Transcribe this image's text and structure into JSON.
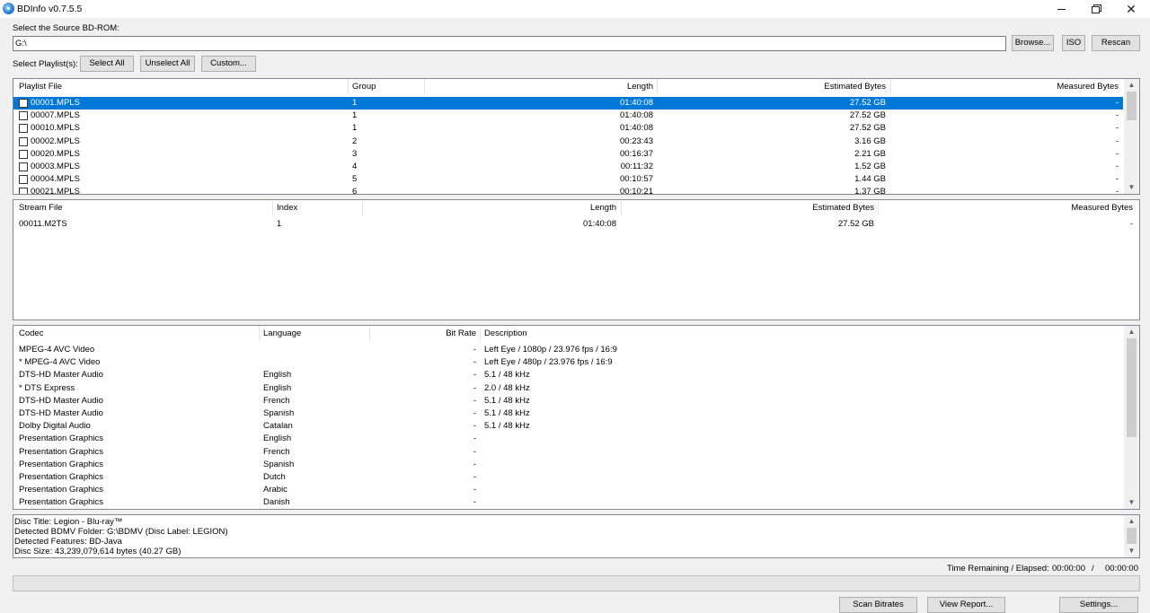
{
  "window": {
    "title": "BDInfo v0.7.5.5",
    "minimize": "–",
    "maximize": "❐",
    "close": "✕"
  },
  "source": {
    "label": "Select the Source BD-ROM:",
    "path": "G:\\",
    "browse": "Browse...",
    "iso": "ISO",
    "rescan": "Rescan"
  },
  "playlists": {
    "label": "Select Playlist(s):",
    "select_all": "Select All",
    "unselect_all": "Unselect All",
    "custom": "Custom...",
    "columns": [
      "Playlist File",
      "Group",
      "Length",
      "Estimated Bytes",
      "Measured Bytes"
    ],
    "rows": [
      {
        "file": "00001.MPLS",
        "group": "1",
        "length": "01:40:08",
        "est": "27.52 GB",
        "meas": "-",
        "selected": true
      },
      {
        "file": "00007.MPLS",
        "group": "1",
        "length": "01:40:08",
        "est": "27.52 GB",
        "meas": "-"
      },
      {
        "file": "00010.MPLS",
        "group": "1",
        "length": "01:40:08",
        "est": "27.52 GB",
        "meas": "-"
      },
      {
        "file": "00002.MPLS",
        "group": "2",
        "length": "00:23:43",
        "est": "3.16 GB",
        "meas": "-"
      },
      {
        "file": "00020.MPLS",
        "group": "3",
        "length": "00:16:37",
        "est": "2.21 GB",
        "meas": "-"
      },
      {
        "file": "00003.MPLS",
        "group": "4",
        "length": "00:11:32",
        "est": "1.52 GB",
        "meas": "-"
      },
      {
        "file": "00004.MPLS",
        "group": "5",
        "length": "00:10:57",
        "est": "1.44 GB",
        "meas": "-"
      },
      {
        "file": "00021.MPLS",
        "group": "6",
        "length": "00:10:21",
        "est": "1.37 GB",
        "meas": "-"
      }
    ]
  },
  "streams": {
    "columns": [
      "Stream File",
      "Index",
      "Length",
      "Estimated Bytes",
      "Measured Bytes"
    ],
    "rows": [
      {
        "file": "00011.M2TS",
        "index": "1",
        "length": "01:40:08",
        "est": "27.52 GB",
        "meas": "-"
      }
    ]
  },
  "codecs": {
    "columns": [
      "Codec",
      "Language",
      "Bit Rate",
      "Description"
    ],
    "rows": [
      {
        "codec": "MPEG-4 AVC Video",
        "lang": "",
        "bitrate": "-",
        "desc": "Left Eye / 1080p / 23.976 fps / 16:9"
      },
      {
        "codec": "* MPEG-4 AVC Video",
        "lang": "",
        "bitrate": "-",
        "desc": "Left Eye / 480p / 23.976 fps / 16:9"
      },
      {
        "codec": "DTS-HD Master Audio",
        "lang": "English",
        "bitrate": "-",
        "desc": "5.1 / 48 kHz"
      },
      {
        "codec": "* DTS Express",
        "lang": "English",
        "bitrate": "-",
        "desc": "2.0 / 48 kHz"
      },
      {
        "codec": "DTS-HD Master Audio",
        "lang": "French",
        "bitrate": "-",
        "desc": "5.1 / 48 kHz"
      },
      {
        "codec": "DTS-HD Master Audio",
        "lang": "Spanish",
        "bitrate": "-",
        "desc": "5.1 / 48 kHz"
      },
      {
        "codec": "Dolby Digital Audio",
        "lang": "Catalan",
        "bitrate": "-",
        "desc": "5.1 / 48 kHz"
      },
      {
        "codec": "Presentation Graphics",
        "lang": "English",
        "bitrate": "-",
        "desc": ""
      },
      {
        "codec": "Presentation Graphics",
        "lang": "French",
        "bitrate": "-",
        "desc": ""
      },
      {
        "codec": "Presentation Graphics",
        "lang": "Spanish",
        "bitrate": "-",
        "desc": ""
      },
      {
        "codec": "Presentation Graphics",
        "lang": "Dutch",
        "bitrate": "-",
        "desc": ""
      },
      {
        "codec": "Presentation Graphics",
        "lang": "Arabic",
        "bitrate": "-",
        "desc": ""
      },
      {
        "codec": "Presentation Graphics",
        "lang": "Danish",
        "bitrate": "-",
        "desc": ""
      }
    ]
  },
  "info": {
    "lines": [
      "Disc Title: Legion - Blu-ray™",
      "Detected BDMV Folder: G:\\BDMV (Disc Label: LEGION)",
      "Detected Features: BD-Java",
      "Disc Size: 43,239,079,614 bytes (40.27 GB)"
    ]
  },
  "status": {
    "label": "Time Remaining / Elapsed:",
    "remaining": "00:00:00",
    "separator": "/",
    "elapsed": "00:00:00",
    "progress": 0
  },
  "footer": {
    "scan": "Scan Bitrates",
    "report": "View Report...",
    "settings": "Settings..."
  },
  "icons": {
    "app": "bdinfo-disc-icon",
    "scroll_up": "▲",
    "scroll_down": "▼"
  }
}
